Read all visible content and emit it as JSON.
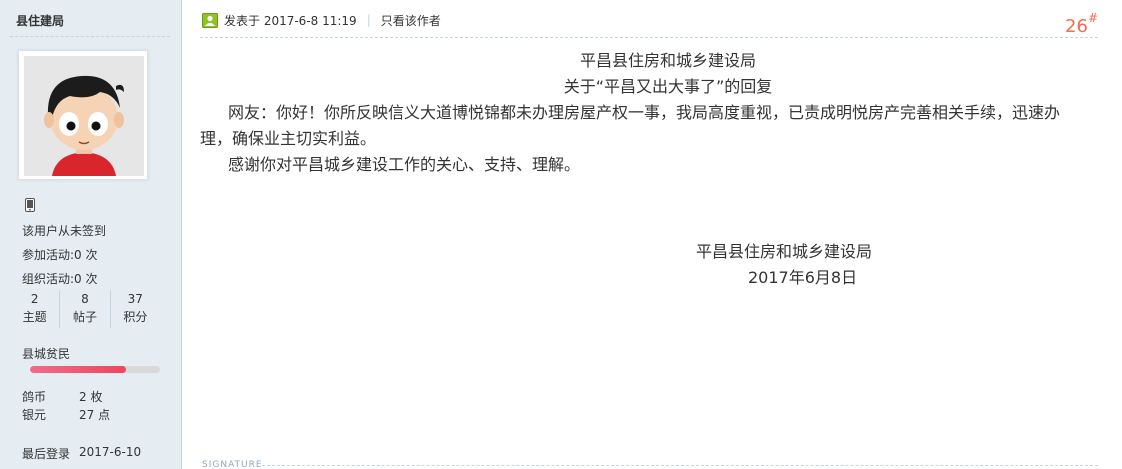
{
  "sidebar": {
    "username": "县住建局",
    "checkin_text": "该用户从未签到",
    "activities_joined": "参加活动:0 次",
    "activities_organized": "组织活动:0 次",
    "stats": [
      {
        "value": "2",
        "label": "主题"
      },
      {
        "value": "8",
        "label": "帖子"
      },
      {
        "value": "37",
        "label": "积分"
      }
    ],
    "rank": "县城贫民",
    "level_progress": 0.74,
    "currency": [
      {
        "label": "鸽币",
        "value": "2 枚"
      },
      {
        "label": "银元",
        "value": "27 点"
      }
    ],
    "last_login_label": "最后登录",
    "last_login_value": "2017-6-10"
  },
  "post": {
    "posted_at": "发表于 2017-6-8 11:19",
    "only_author": "只看该作者",
    "floor_number": "26",
    "floor_symbol": "#",
    "org_title": "平昌县住房和城乡建设局",
    "subject": "关于“平昌又出大事了”的回复",
    "paragraph1": "网友：你好！你所反映信义大道博悦锦都未办理房屋产权一事，我局高度重视，已责成明悦房产完善相关手续，迅速办理，确保业主切实利益。",
    "paragraph2": "感谢你对平昌城乡建设工作的关心、支持、理解。",
    "sign_org": "平昌县住房和城乡建设局",
    "sign_date": "2017年6月8日",
    "signature_label": "SIGNATURE"
  },
  "colors": {
    "sidebar_bg": "#e5edf2",
    "floor_color": "#f26c4f",
    "level_fill": "#f0455f",
    "online_icon": "#8fc31f"
  },
  "icons": {
    "online": "user-online-icon",
    "phone": "mobile-phone-icon"
  }
}
